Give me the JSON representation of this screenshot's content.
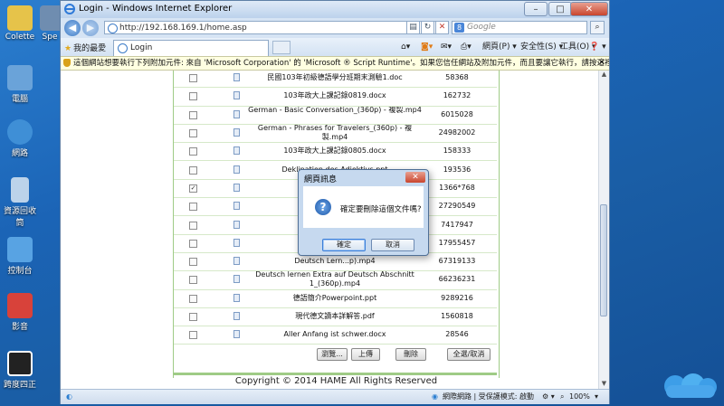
{
  "desktop": {
    "icons": [
      {
        "label": "Colette",
        "color": "#e6c34a"
      },
      {
        "label": "Spe",
        "color": "#6f8db0"
      },
      {
        "label": "電腦",
        "color": "#6aa3d9"
      },
      {
        "label": "網路",
        "color": "#3f8fd6"
      },
      {
        "label": "資源回收筒",
        "color": "#bcd3ea"
      },
      {
        "label": "控制台",
        "color": "#58a3e3"
      },
      {
        "label": "影音",
        "color": "#d8423a"
      },
      {
        "label": "跨度四正",
        "color": "#222222"
      }
    ]
  },
  "window": {
    "title": "Login - Windows Internet Explorer",
    "controls": {
      "minimize": "–",
      "maximize": "□",
      "close": "✕"
    },
    "address": "http://192.168.169.1/home.asp",
    "search_placeholder": "Google",
    "favorites_label": "我的最愛",
    "tab_title": "Login",
    "commands": [
      "網頁(P) ▾",
      "安全性(S) ▾",
      "工具(O) ▾",
      "❓ ▾"
    ],
    "infobar_text": "這個網站想要執行下列附加元件: 來自 'Microsoft Corporation' 的 'Microsoft ® Script Runtime'。如果您信任網站及附加元件，而且要讓它執行，請按這裡...",
    "status_text": "網際網路 | 受保護模式: 啟動",
    "zoom": "100%"
  },
  "files": [
    {
      "name": "民國103年初級德語學分班期末測驗1.doc",
      "size": "58368",
      "checked": false
    },
    {
      "name": "103年政大上課記錄0819.docx",
      "size": "162732",
      "checked": false
    },
    {
      "name": "German - Basic Conversation_(360p) - 複製.mp4",
      "size": "6015028",
      "checked": false
    },
    {
      "name": "German - Phrases for Travelers_(360p) - 複製.mp4",
      "size": "24982002",
      "checked": false
    },
    {
      "name": "103年政大上課記錄0805.docx",
      "size": "158333",
      "checked": false
    },
    {
      "name": "Deklination des Adjektivs.ppt",
      "size": "193536",
      "checked": false
    },
    {
      "name": "",
      "size": "1366*768",
      "checked": true
    },
    {
      "name": "",
      "size": "27290549",
      "checked": false
    },
    {
      "name": "",
      "size": "7417947",
      "checked": false
    },
    {
      "name": "",
      "size": "17955457",
      "checked": false
    },
    {
      "name": "Deutsch Lern...p).mp4",
      "size": "67319133",
      "checked": false
    },
    {
      "name": "Deutsch lernen Extra auf Deutsch Abschnitt 1_(360p).mp4",
      "size": "66236231",
      "checked": false
    },
    {
      "name": "德語簡介Powerpoint.ppt",
      "size": "9289216",
      "checked": false
    },
    {
      "name": "現代德文讀本詳解答.pdf",
      "size": "1560818",
      "checked": false
    },
    {
      "name": "Aller Anfang ist schwer.docx",
      "size": "28546",
      "checked": false
    }
  ],
  "buttons": {
    "browse": "瀏覽...",
    "upload": "上傳",
    "delete": "刪除",
    "select_all": "全選/取消"
  },
  "copyright": "Copyright © 2014 HAME All Rights Reserved",
  "dialog": {
    "title": "網頁訊息",
    "close": "✕",
    "message": "確定要刪除這個文件嗎?",
    "ok": "確定",
    "cancel": "取消"
  }
}
